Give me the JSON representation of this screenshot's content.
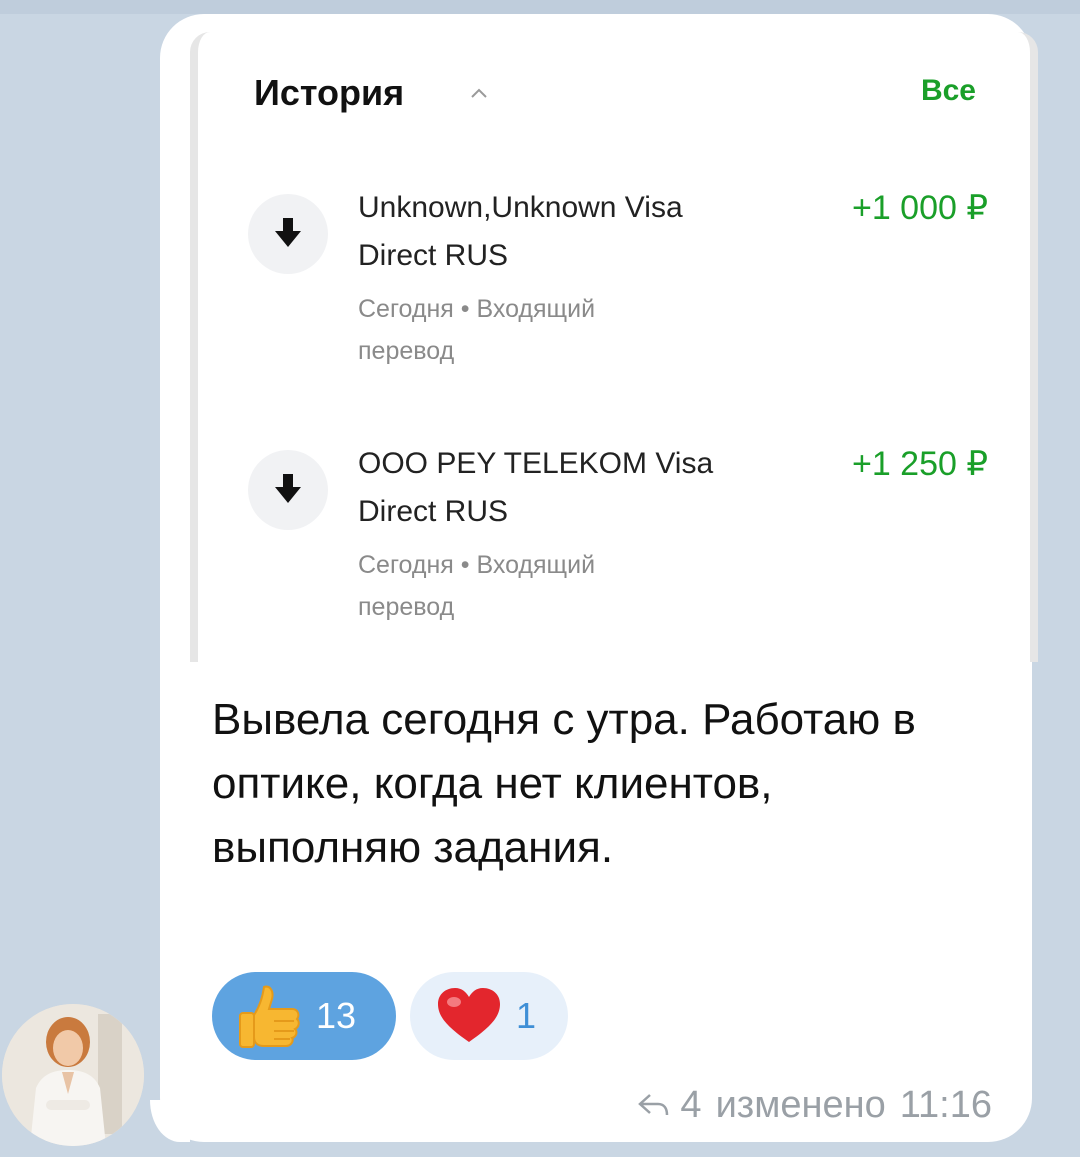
{
  "history": {
    "title": "История",
    "all_link": "Все",
    "transactions": [
      {
        "name": "Unknown,Unknown Visa Direct RUS",
        "amount": "+1 000 ₽",
        "meta": "Сегодня • Входящий перевод"
      },
      {
        "name": "ООО PEY TELEKOM Visa Direct RUS",
        "amount": "+1 250 ₽",
        "meta": "Сегодня • Входящий перевод"
      }
    ]
  },
  "message": {
    "text": "Вывела сегодня с утра. Работаю в оптике, когда нет клиентов, выполняю задания.",
    "reactions": [
      {
        "icon": "thumbs-up-icon",
        "count": "13"
      },
      {
        "icon": "heart-icon",
        "count": "1"
      }
    ],
    "replies": "4",
    "edited_label": "изменено",
    "time": "11:16"
  },
  "colors": {
    "background": "#c9d6e3",
    "accent_green": "#1a9f29",
    "reaction_blue": "#5ea3e0",
    "reaction_light": "#e7f0fa"
  }
}
